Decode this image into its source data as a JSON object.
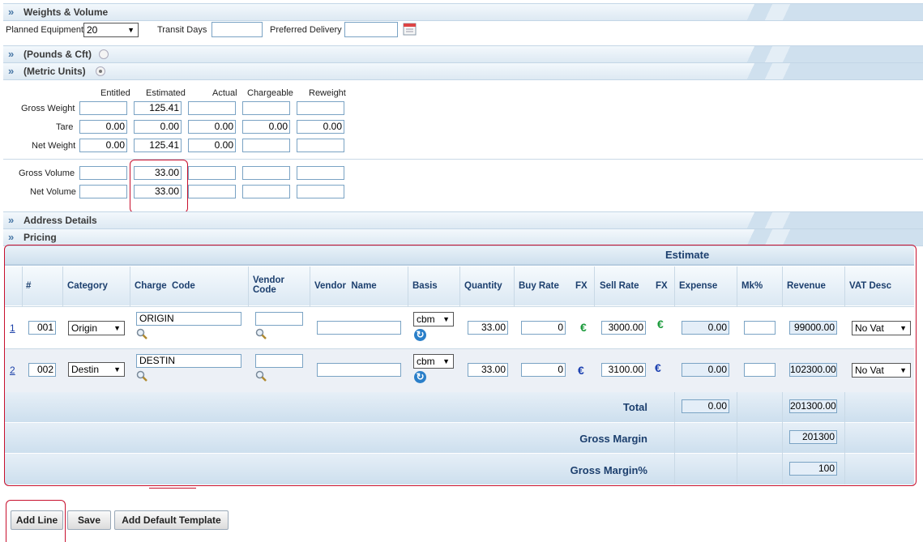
{
  "sections": {
    "weights_volume": "Weights & Volume",
    "pounds_cft": "(Pounds & Cft)",
    "metric_units": "(Metric Units)",
    "address_details": "Address Details",
    "pricing": "Pricing"
  },
  "weights": {
    "planned_equipment_label": "Planned Equipment",
    "planned_equipment_value": "20",
    "transit_days_label": "Transit Days",
    "transit_days_value": "",
    "preferred_delivery_label": "Preferred Delivery",
    "preferred_delivery_value": ""
  },
  "measure": {
    "columns": [
      "Entitled",
      "Estimated",
      "Actual",
      "Chargeable",
      "Reweight"
    ],
    "rows": [
      {
        "label": "Gross Weight",
        "values": [
          "",
          "125.41",
          "",
          "",
          ""
        ]
      },
      {
        "label": "Tare",
        "values": [
          "0.00",
          "0.00",
          "0.00",
          "0.00",
          "0.00"
        ]
      },
      {
        "label": "Net Weight",
        "values": [
          "0.00",
          "125.41",
          "0.00",
          "",
          ""
        ]
      },
      {
        "label": "Gross Volume",
        "values": [
          "",
          "33.00",
          "",
          "",
          ""
        ]
      },
      {
        "label": "Net Volume",
        "values": [
          "",
          "33.00",
          "",
          "",
          ""
        ]
      }
    ]
  },
  "pricing": {
    "estimate_title": "Estimate",
    "headers": {
      "num": "#",
      "category": "Category",
      "charge_code": "Charge  Code",
      "vendor_code": "Vendor Code",
      "vendor_name": "Vendor  Name",
      "basis": "Basis",
      "quantity": "Quantity",
      "buy_rate": "Buy Rate",
      "fx1": "FX",
      "sell_rate": "Sell Rate",
      "fx2": "FX",
      "expense": "Expense",
      "mk": "Mk%",
      "revenue": "Revenue",
      "vat_desc": "VAT Desc"
    },
    "rows": [
      {
        "link": "1",
        "num": "001",
        "category": "Origin",
        "charge_code": "ORIGIN",
        "vendor_code": "",
        "vendor_name": "",
        "basis": "cbm",
        "quantity": "33.00",
        "buy_rate": "0",
        "sell_rate": "3000.00",
        "expense": "0.00",
        "mk": "",
        "revenue": "99000.00",
        "vat": "No Vat"
      },
      {
        "link": "2",
        "num": "002",
        "category": "Destin",
        "charge_code": "DESTIN",
        "vendor_code": "",
        "vendor_name": "",
        "basis": "cbm",
        "quantity": "33.00",
        "buy_rate": "0",
        "sell_rate": "3100.00",
        "expense": "0.00",
        "mk": "",
        "revenue": "102300.00",
        "vat": "No Vat"
      }
    ],
    "euro_symbol": "€",
    "total_label": "Total",
    "total_expense": "0.00",
    "total_revenue": "201300.00",
    "gross_margin_label": "Gross Margin",
    "gross_margin": "201300",
    "gross_margin_pct_label": "Gross Margin%",
    "gross_margin_pct": "100"
  },
  "buttons": {
    "add_line": "Add Line",
    "save": "Save",
    "add_default_template": "Add Default Template"
  },
  "colors": {
    "highlight": "#c8102e",
    "euro_green": "#1a9a3a",
    "euro_blue": "#1a3fb0"
  }
}
